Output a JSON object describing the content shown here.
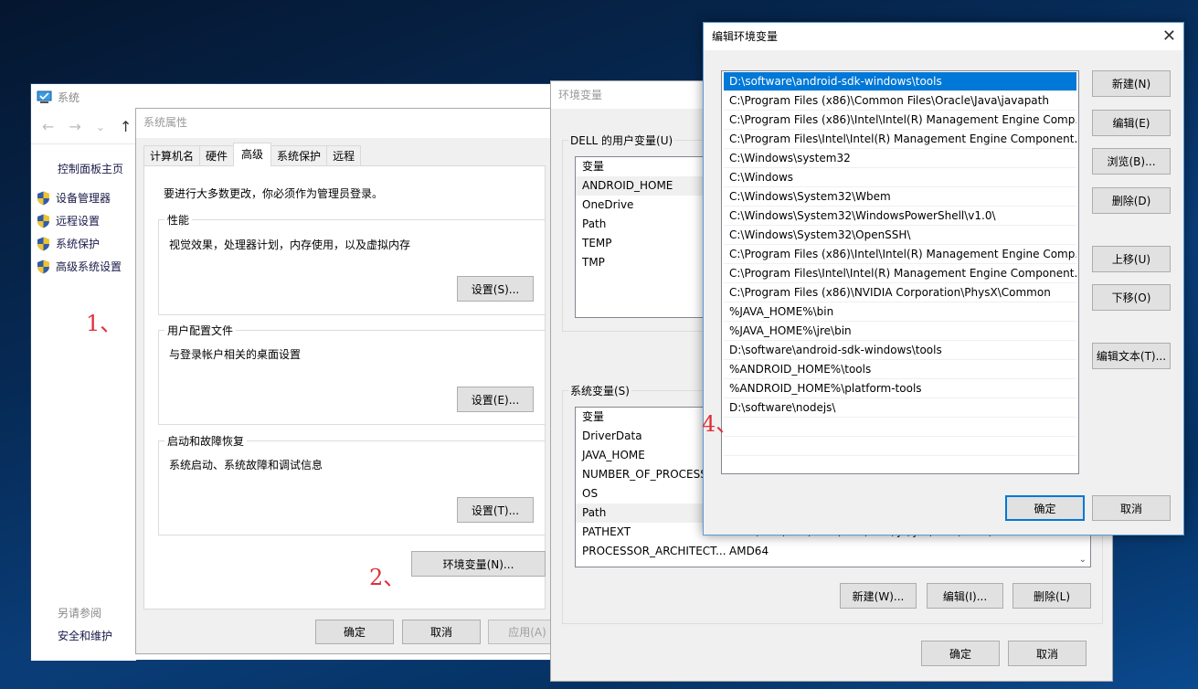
{
  "system_window": {
    "title": "系统",
    "nav": {
      "back": "←",
      "forward": "→",
      "recent": "⌄",
      "up": "↑"
    },
    "sidebar": {
      "home_link": "控制面板主页",
      "items": [
        {
          "label": "设备管理器",
          "icon": "shield-icon"
        },
        {
          "label": "远程设置",
          "icon": "shield-icon"
        },
        {
          "label": "系统保护",
          "icon": "shield-icon"
        },
        {
          "label": "高级系统设置",
          "icon": "shield-icon"
        }
      ],
      "see_also_heading": "另请参阅",
      "see_also_link": "安全和维护"
    }
  },
  "system_properties": {
    "title": "系统属性",
    "tabs": [
      {
        "label": "计算机名",
        "active": false
      },
      {
        "label": "硬件",
        "active": false
      },
      {
        "label": "高级",
        "active": true
      },
      {
        "label": "系统保护",
        "active": false
      },
      {
        "label": "远程",
        "active": false
      }
    ],
    "admin_note": "要进行大多数更改，你必须作为管理员登录。",
    "performance": {
      "legend": "性能",
      "description": "视觉效果，处理器计划，内存使用，以及虚拟内存",
      "button": "设置(S)..."
    },
    "user_profiles": {
      "legend": "用户配置文件",
      "description": "与登录帐户相关的桌面设置",
      "button": "设置(E)..."
    },
    "startup_recovery": {
      "legend": "启动和故障恢复",
      "description": "系统启动、系统故障和调试信息",
      "button": "设置(T)..."
    },
    "env_button": "环境变量(N)...",
    "ok": "确定",
    "cancel": "取消",
    "apply": "应用(A)"
  },
  "env_vars_dialog": {
    "title": "环境变量",
    "user_vars": {
      "legend": "DELL 的用户变量(U)",
      "column_header": "变量",
      "rows": [
        "ANDROID_HOME",
        "OneDrive",
        "Path",
        "TEMP",
        "TMP"
      ],
      "selected": "ANDROID_HOME"
    },
    "system_vars": {
      "legend": "系统变量(S)",
      "column_header": "变量",
      "rows": [
        {
          "name": "DriverData",
          "value": ""
        },
        {
          "name": "JAVA_HOME",
          "value": ""
        },
        {
          "name": "NUMBER_OF_PROCESS",
          "value": ""
        },
        {
          "name": "OS",
          "value": ""
        },
        {
          "name": "Path",
          "value": ""
        },
        {
          "name": "PATHEXT",
          "value": ".COM;.EXE;.BAT;.CMD;.VBS;.VBE;.JS;.JSE;.WSF;.WSH;.MSC"
        },
        {
          "name": "PROCESSOR_ARCHITECT...",
          "value": "AMD64"
        }
      ],
      "selected": "Path"
    },
    "new_button": "新建(W)...",
    "edit_button": "编辑(I)...",
    "delete_button": "删除(L)",
    "ok": "确定",
    "cancel": "取消"
  },
  "edit_env_dialog": {
    "title": "编辑环境变量",
    "close": "✕",
    "paths": [
      "D:\\software\\android-sdk-windows\\tools",
      "C:\\Program Files (x86)\\Common Files\\Oracle\\Java\\javapath",
      "C:\\Program Files (x86)\\Intel\\Intel(R) Management Engine Comp...",
      "C:\\Program Files\\Intel\\Intel(R) Management Engine Component...",
      "C:\\Windows\\system32",
      "C:\\Windows",
      "C:\\Windows\\System32\\Wbem",
      "C:\\Windows\\System32\\WindowsPowerShell\\v1.0\\",
      "C:\\Windows\\System32\\OpenSSH\\",
      "C:\\Program Files (x86)\\Intel\\Intel(R) Management Engine Comp...",
      "C:\\Program Files\\Intel\\Intel(R) Management Engine Component...",
      "C:\\Program Files (x86)\\NVIDIA Corporation\\PhysX\\Common",
      "%JAVA_HOME%\\bin",
      "%JAVA_HOME%\\jre\\bin",
      "D:\\software\\android-sdk-windows\\tools",
      "%ANDROID_HOME%\\tools",
      "%ANDROID_HOME%\\platform-tools",
      "D:\\software\\nodejs\\",
      "",
      ""
    ],
    "selected_index": 0,
    "buttons": {
      "new": "新建(N)",
      "edit": "编辑(E)",
      "browse": "浏览(B)...",
      "delete": "删除(D)",
      "move_up": "上移(U)",
      "move_down": "下移(O)",
      "edit_text": "编辑文本(T)..."
    },
    "ok": "确定",
    "cancel": "取消"
  },
  "annotations": [
    "1、",
    "2、",
    "4、"
  ],
  "colors": {
    "selection": "#0078d7",
    "annotation": "#e0303a",
    "dialog_bg": "#f0f0f0"
  }
}
